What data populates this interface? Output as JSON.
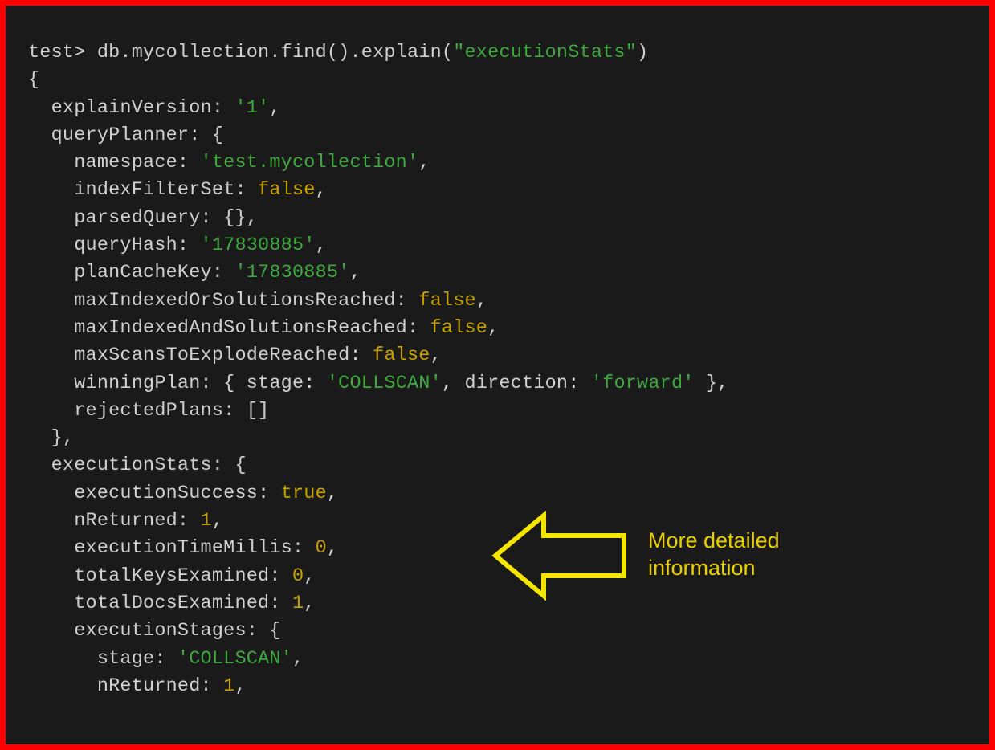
{
  "prompt": "test> ",
  "command": "db.mycollection.find().explain(",
  "command_arg": "\"executionStats\"",
  "command_tail": ")",
  "lines": {
    "openBrace": "{",
    "explainVersion_key": "  explainVersion: ",
    "explainVersion_val": "'1'",
    "queryPlanner_key": "  queryPlanner: {",
    "namespace_key": "    namespace: ",
    "namespace_val": "'test.mycollection'",
    "indexFilterSet_key": "    indexFilterSet: ",
    "indexFilterSet_val": "false",
    "parsedQuery": "    parsedQuery: {},",
    "queryHash_key": "    queryHash: ",
    "queryHash_val": "'17830885'",
    "planCacheKey_key": "    planCacheKey: ",
    "planCacheKey_val": "'17830885'",
    "maxIndexedOr_key": "    maxIndexedOrSolutionsReached: ",
    "maxIndexedOr_val": "false",
    "maxIndexedAnd_key": "    maxIndexedAndSolutionsReached: ",
    "maxIndexedAnd_val": "false",
    "maxScans_key": "    maxScansToExplodeReached: ",
    "maxScans_val": "false",
    "winningPlan_key": "    winningPlan: { stage: ",
    "winningPlan_stage": "'COLLSCAN'",
    "winningPlan_mid": ", direction: ",
    "winningPlan_dir": "'forward'",
    "winningPlan_tail": " },",
    "rejectedPlans": "    rejectedPlans: []",
    "closeQP": "  },",
    "executionStats_key": "  executionStats: {",
    "execSuccess_key": "    executionSuccess: ",
    "execSuccess_val": "true",
    "nReturned_key": "    nReturned: ",
    "nReturned_val": "1",
    "execTime_key": "    executionTimeMillis: ",
    "execTime_val": "0",
    "totalKeys_key": "    totalKeysExamined: ",
    "totalKeys_val": "0",
    "totalDocs_key": "    totalDocsExamined: ",
    "totalDocs_val": "1",
    "execStages_key": "    executionStages: {",
    "stage_key": "      stage: ",
    "stage_val": "'COLLSCAN'",
    "nReturned2_key": "      nReturned: ",
    "nReturned2_val": "1",
    "comma": ","
  },
  "annotation": {
    "line1": "More detailed",
    "line2": "information"
  }
}
